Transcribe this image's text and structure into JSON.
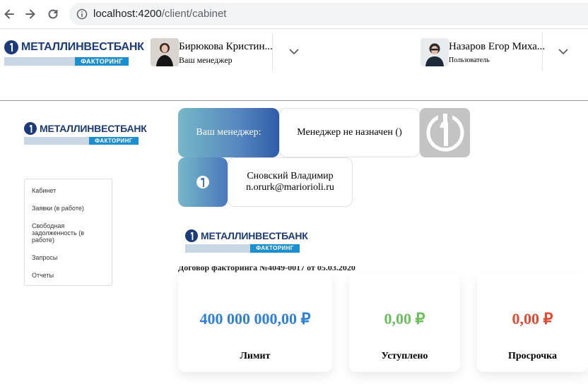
{
  "browser": {
    "url_host": "localhost:4200",
    "url_path": "/client/cabinet"
  },
  "brand": {
    "name": "МЕТАЛЛИНВЕСТБАНК",
    "sub": "ФАКТОРИНГ",
    "primary": "#1b3b7a",
    "accent": "#1c8fd0"
  },
  "header": {
    "manager": {
      "name": "Бирюкова Кристин...",
      "role": "Ваш менеджер"
    },
    "user": {
      "name": "Назаров Егор Миха...",
      "role": "Пользователь"
    }
  },
  "sidebar": {
    "items": [
      {
        "label": "Кабинет"
      },
      {
        "label": "Заявки (в работе)"
      },
      {
        "label": "Свободная задолженность (в работе)"
      },
      {
        "label": "Запросы"
      },
      {
        "label": "Отчеты"
      }
    ]
  },
  "main": {
    "manager_label": "Ваш менеджер:",
    "manager_value": "Менеджер не назначен ()",
    "contact_name": "Сновский Владимир",
    "contact_email": "n.orurk@mariorioli.ru",
    "contract_text": "Договор факторинга №4049-0017 от 05.03.2020"
  },
  "stats": [
    {
      "value": "400 000 000,00 ₽",
      "label": "Лимит",
      "color": "#2d80dc"
    },
    {
      "value": "0,00 ₽",
      "label": "Уступлено",
      "color": "#6cc05c"
    },
    {
      "value": "0,00 ₽",
      "label": "Просрочка",
      "color": "#e04a32"
    }
  ]
}
